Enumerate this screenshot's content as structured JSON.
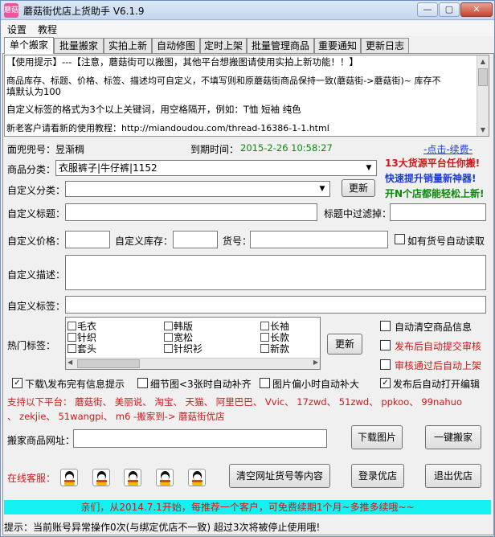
{
  "window": {
    "title": "蘑菇街优店上货助手 V6.1.9",
    "icon_text": "蘑菇"
  },
  "menu": [
    "设置",
    "教程"
  ],
  "tabs": [
    "单个搬家",
    "批量搬家",
    "实拍上新",
    "自动修图",
    "定时上架",
    "批量管理商品",
    "重要通知",
    "更新日志"
  ],
  "notice": [
    "【使用提示】---【注意，蘑菇街可以搬图，其他平台想搬图请使用实拍上新功能！！】",
    "",
    "商品库存、标题、价格、标签、描述均可自定义，不填写则和原蘑菇街商品保持一致(蘑菇街->蘑菇街)~ 库存不",
    "填默认为100",
    "",
    "自定义标签的格式为3个以上关键词，用空格隔开，例如：T恤 短袖 纯色",
    "",
    "新老客户请看新的使用教程：http://miandoudou.com/thread-16386-1-1.html"
  ],
  "account": {
    "shop_label": "面兜兜号：",
    "shop_value": "昱渐稠",
    "expire_label": "到期时间：",
    "expire_value": "2015-2-26 10:58:27",
    "renew_link": "-点击-续费-"
  },
  "promo": [
    "13大货源平台任你搬!",
    "快速提升销量新神器!",
    "开N个店都能轻松上新!"
  ],
  "form": {
    "category_label": "商品分类：",
    "category_value": "衣服裤子|牛仔裤|1152",
    "custom_category_label": "自定义分类：",
    "custom_category_value": "",
    "refresh_btn": "更新",
    "custom_title_label": "自定义标题：",
    "title_filter_label": "标题中过滤掉：",
    "custom_price_label": "自定义价格：",
    "custom_stock_label": "自定义库存：",
    "sku_label": "货号：",
    "auto_read_sku": "如有货号自动读取",
    "custom_desc_label": "自定义描述：",
    "custom_tags_label": "自定义标签：",
    "hot_tags_label": "热门标签：",
    "hot_tags": [
      [
        "毛衣",
        "韩版",
        "长袖"
      ],
      [
        "针织",
        "宽松",
        "长款"
      ],
      [
        "套头",
        "针织衫",
        "新款"
      ]
    ],
    "hot_tags_refresh": "更新"
  },
  "right_options": [
    {
      "label": "自动清空商品信息",
      "checked": false,
      "red": false
    },
    {
      "label": "发布后自动提交审核",
      "checked": false,
      "red": true
    },
    {
      "label": "审核通过后自动上架",
      "checked": false,
      "red": true
    }
  ],
  "bottom_options": [
    {
      "label": "下载\\发布完有信息提示",
      "checked": true
    },
    {
      "label": "细节图<3张时自动补齐",
      "checked": false
    },
    {
      "label": "图片偏小时自动补大",
      "checked": false
    },
    {
      "label": "发布后自动打开编辑",
      "checked": true
    }
  ],
  "platforms_line1": "支持以下平台： 蘑菇街、 美丽说、 淘宝、 天猫、 阿里巴巴、 Vvic、 17zwd、 51zwd、 ppkoo、 99nahuo",
  "platforms_line2": "、 zekjie、 51wangpi、 m6 -搬家到-> 蘑菇街优店",
  "url": {
    "label": "搬家商品网址：",
    "value": "",
    "download_btn": "下载图片",
    "move_btn": "一键搬家"
  },
  "support": {
    "label": "在线客服：",
    "count": 5,
    "clear_btn": "清空网址货号等内容",
    "login_btn": "登录优店",
    "logout_btn": "退出优店"
  },
  "banner": "亲们，从2014.7.1开始，每推荐一个客户，可免费续期1个月~多推多续哦~~",
  "status": "提示：当前账号异常操作0次(与绑定优店不一致) 超过3次将被停止使用哦!",
  "colors": {
    "accent_red": "#d01818",
    "promo_blue": "#1a3bd6",
    "promo_green": "#0a8a0a",
    "banner_bg": "#15f0f0"
  }
}
